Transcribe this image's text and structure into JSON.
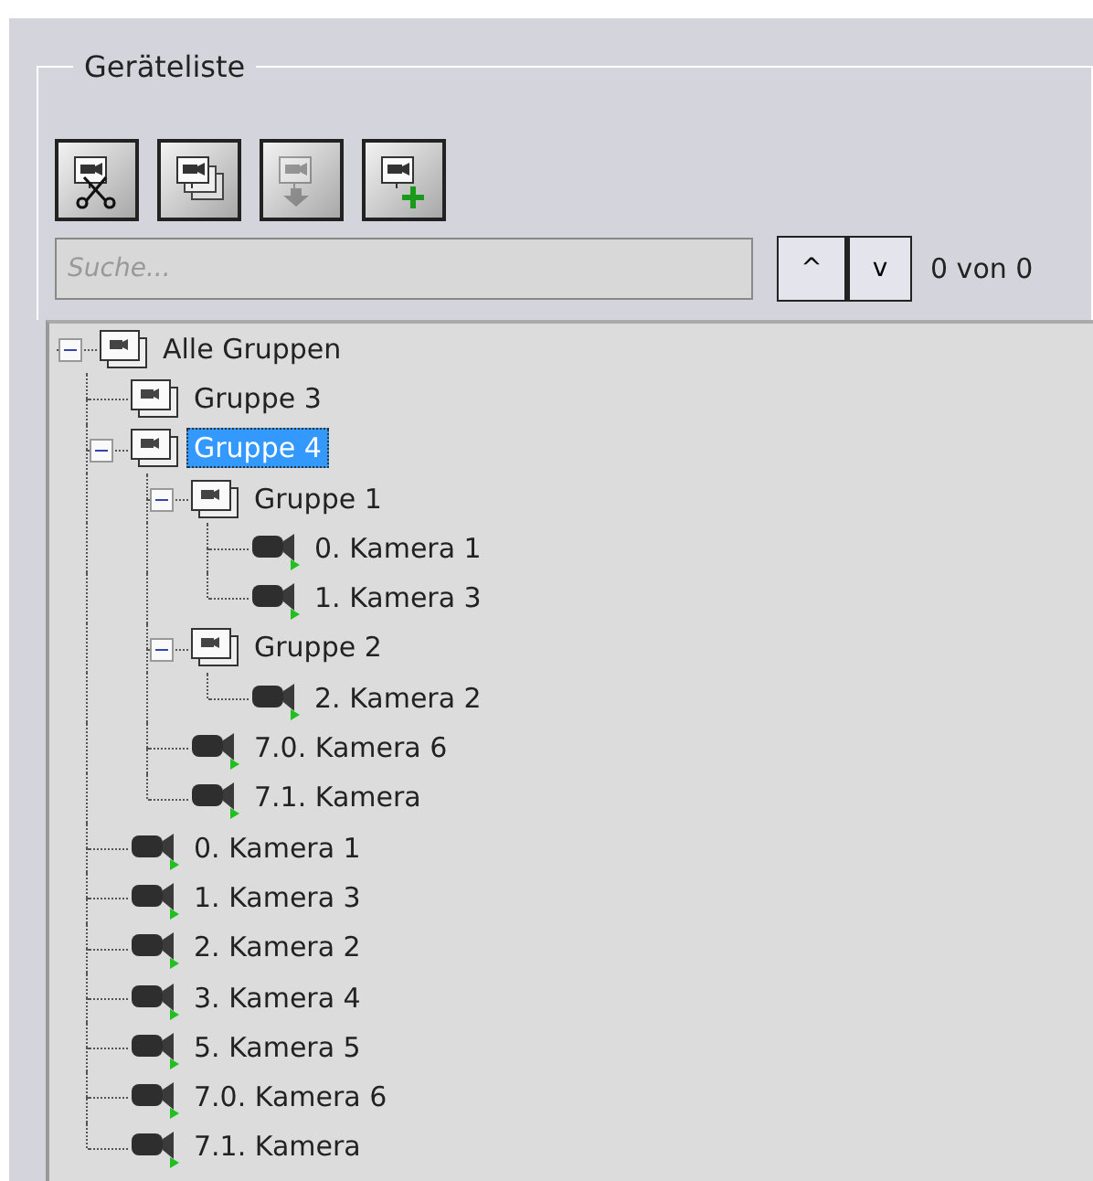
{
  "panel": {
    "title": "Geräteliste"
  },
  "toolbar": [
    {
      "kind": "cut",
      "disabled": false
    },
    {
      "kind": "copy",
      "disabled": false
    },
    {
      "kind": "move",
      "disabled": true
    },
    {
      "kind": "add",
      "disabled": false
    }
  ],
  "search": {
    "placeholder": "Suche...",
    "previous": "^",
    "next": "v",
    "count": "0 von 0"
  },
  "tree": [
    {
      "kind": "group",
      "label": "Alle Gruppen",
      "selected": false,
      "expanded": true,
      "children": [
        {
          "kind": "group",
          "label": "Gruppe 3",
          "selected": false
        },
        {
          "kind": "group",
          "label": "Gruppe 4",
          "selected": true,
          "expanded": true,
          "children": [
            {
              "kind": "group",
              "label": "Gruppe 1",
              "selected": false,
              "expanded": true,
              "children": [
                {
                  "kind": "camera",
                  "label": "0. Kamera 1",
                  "selected": false
                },
                {
                  "kind": "camera",
                  "label": "1. Kamera 3",
                  "selected": false
                }
              ]
            },
            {
              "kind": "group",
              "label": "Gruppe 2",
              "selected": false,
              "expanded": true,
              "children": [
                {
                  "kind": "camera",
                  "label": "2. Kamera 2",
                  "selected": false
                }
              ]
            },
            {
              "kind": "camera",
              "label": "7.0. Kamera 6",
              "selected": false
            },
            {
              "kind": "camera",
              "label": "7.1. Kamera",
              "selected": false
            }
          ]
        },
        {
          "kind": "camera",
          "label": "0. Kamera 1",
          "selected": false
        },
        {
          "kind": "camera",
          "label": "1. Kamera 3",
          "selected": false
        },
        {
          "kind": "camera",
          "label": "2. Kamera 2",
          "selected": false
        },
        {
          "kind": "camera",
          "label": "3. Kamera 4",
          "selected": false
        },
        {
          "kind": "camera",
          "label": "5. Kamera 5",
          "selected": false
        },
        {
          "kind": "camera",
          "label": "7.0. Kamera 6",
          "selected": false
        },
        {
          "kind": "camera",
          "label": "7.1. Kamera",
          "selected": false
        }
      ]
    }
  ]
}
